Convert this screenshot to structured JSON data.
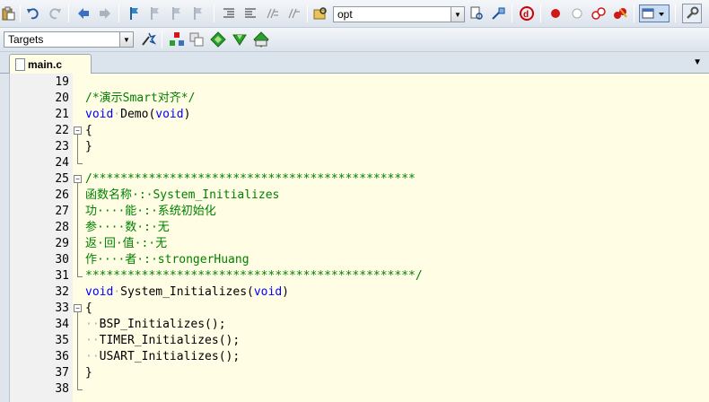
{
  "toolbar1": {
    "find_combo_value": "opt"
  },
  "toolbar2": {
    "target_combo_value": "Targets"
  },
  "tabs": [
    {
      "label": "main.c"
    }
  ],
  "editor": {
    "lines": [
      {
        "num": "19"
      },
      {
        "num": "20",
        "segments": [
          {
            "text": "/*演示Smart对齐*/",
            "cls": "cm"
          }
        ]
      },
      {
        "num": "21",
        "segments": [
          {
            "text": "void",
            "cls": "kw"
          },
          {
            "text": "·",
            "cls": "dot"
          },
          {
            "text": "Demo("
          },
          {
            "text": "void",
            "cls": "kw"
          },
          {
            "text": ")"
          }
        ]
      },
      {
        "num": "22",
        "segments": [
          {
            "text": "{"
          }
        ]
      },
      {
        "num": "23",
        "segments": [
          {
            "text": "}"
          }
        ]
      },
      {
        "num": "24"
      },
      {
        "num": "25",
        "segments": [
          {
            "text": "/**********************************************",
            "cls": "cm"
          }
        ]
      },
      {
        "num": "26",
        "segments": [
          {
            "text": "函数名称·:·System_Initializes",
            "cls": "cm"
          }
        ]
      },
      {
        "num": "27",
        "segments": [
          {
            "text": "功····能·:·系统初始化",
            "cls": "cm"
          }
        ]
      },
      {
        "num": "28",
        "segments": [
          {
            "text": "参····数·:·无",
            "cls": "cm"
          }
        ]
      },
      {
        "num": "29",
        "segments": [
          {
            "text": "返·回·值·:·无",
            "cls": "cm"
          }
        ]
      },
      {
        "num": "30",
        "segments": [
          {
            "text": "作····者·:·strongerHuang",
            "cls": "cm"
          }
        ]
      },
      {
        "num": "31",
        "segments": [
          {
            "text": "***********************************************/",
            "cls": "cm"
          }
        ]
      },
      {
        "num": "32",
        "segments": [
          {
            "text": "void",
            "cls": "kw"
          },
          {
            "text": "·",
            "cls": "dot"
          },
          {
            "text": "System_Initializes("
          },
          {
            "text": "void",
            "cls": "kw"
          },
          {
            "text": ")"
          }
        ]
      },
      {
        "num": "33",
        "segments": [
          {
            "text": "{"
          }
        ]
      },
      {
        "num": "34",
        "segments": [
          {
            "text": "··",
            "cls": "dot"
          },
          {
            "text": "BSP_Initializes();"
          }
        ]
      },
      {
        "num": "35",
        "segments": [
          {
            "text": "··",
            "cls": "dot"
          },
          {
            "text": "TIMER_Initializes();"
          }
        ]
      },
      {
        "num": "36",
        "segments": [
          {
            "text": "··",
            "cls": "dot"
          },
          {
            "text": "USART_Initializes();"
          }
        ]
      },
      {
        "num": "37",
        "segments": [
          {
            "text": "}"
          }
        ]
      },
      {
        "num": "38"
      }
    ]
  },
  "colors": {
    "editor_bg": "#fffde4",
    "keyword": "#0000ff",
    "comment": "#008000",
    "gutter_bg": "#f1f1f1",
    "toolbar_bg": "#dbe3ec"
  }
}
